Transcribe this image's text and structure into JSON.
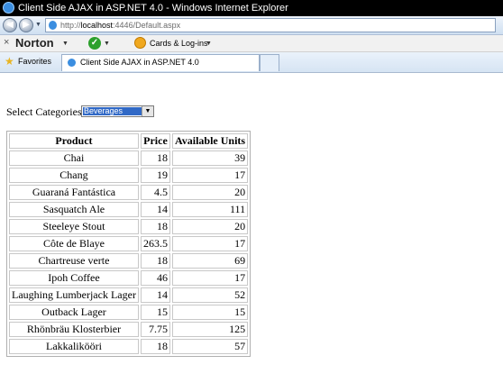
{
  "window": {
    "title": "Client Side AJAX in ASP.NET 4.0 - Windows Internet Explorer"
  },
  "address": {
    "prefix": "http://",
    "host": "localhost",
    "rest": ":4446/Default.aspx"
  },
  "toolbar": {
    "norton_label": "Norton",
    "cards_label": "Cards & Log-ins"
  },
  "favorites": {
    "label": "Favorites"
  },
  "tab": {
    "label": "Client Side AJAX in ASP.NET 4.0"
  },
  "filter": {
    "label": "Select Categories :",
    "selected": "Beverages"
  },
  "table": {
    "headers": [
      "Product",
      "Price",
      "Available Units"
    ],
    "rows": [
      [
        "Chai",
        "18",
        "39"
      ],
      [
        "Chang",
        "19",
        "17"
      ],
      [
        "Guaraná Fantástica",
        "4.5",
        "20"
      ],
      [
        "Sasquatch Ale",
        "14",
        "111"
      ],
      [
        "Steeleye Stout",
        "18",
        "20"
      ],
      [
        "Côte de Blaye",
        "263.5",
        "17"
      ],
      [
        "Chartreuse verte",
        "18",
        "69"
      ],
      [
        "Ipoh Coffee",
        "46",
        "17"
      ],
      [
        "Laughing Lumberjack Lager",
        "14",
        "52"
      ],
      [
        "Outback Lager",
        "15",
        "15"
      ],
      [
        "Rhönbräu Klosterbier",
        "7.75",
        "125"
      ],
      [
        "Lakkalikööri",
        "18",
        "57"
      ]
    ]
  }
}
